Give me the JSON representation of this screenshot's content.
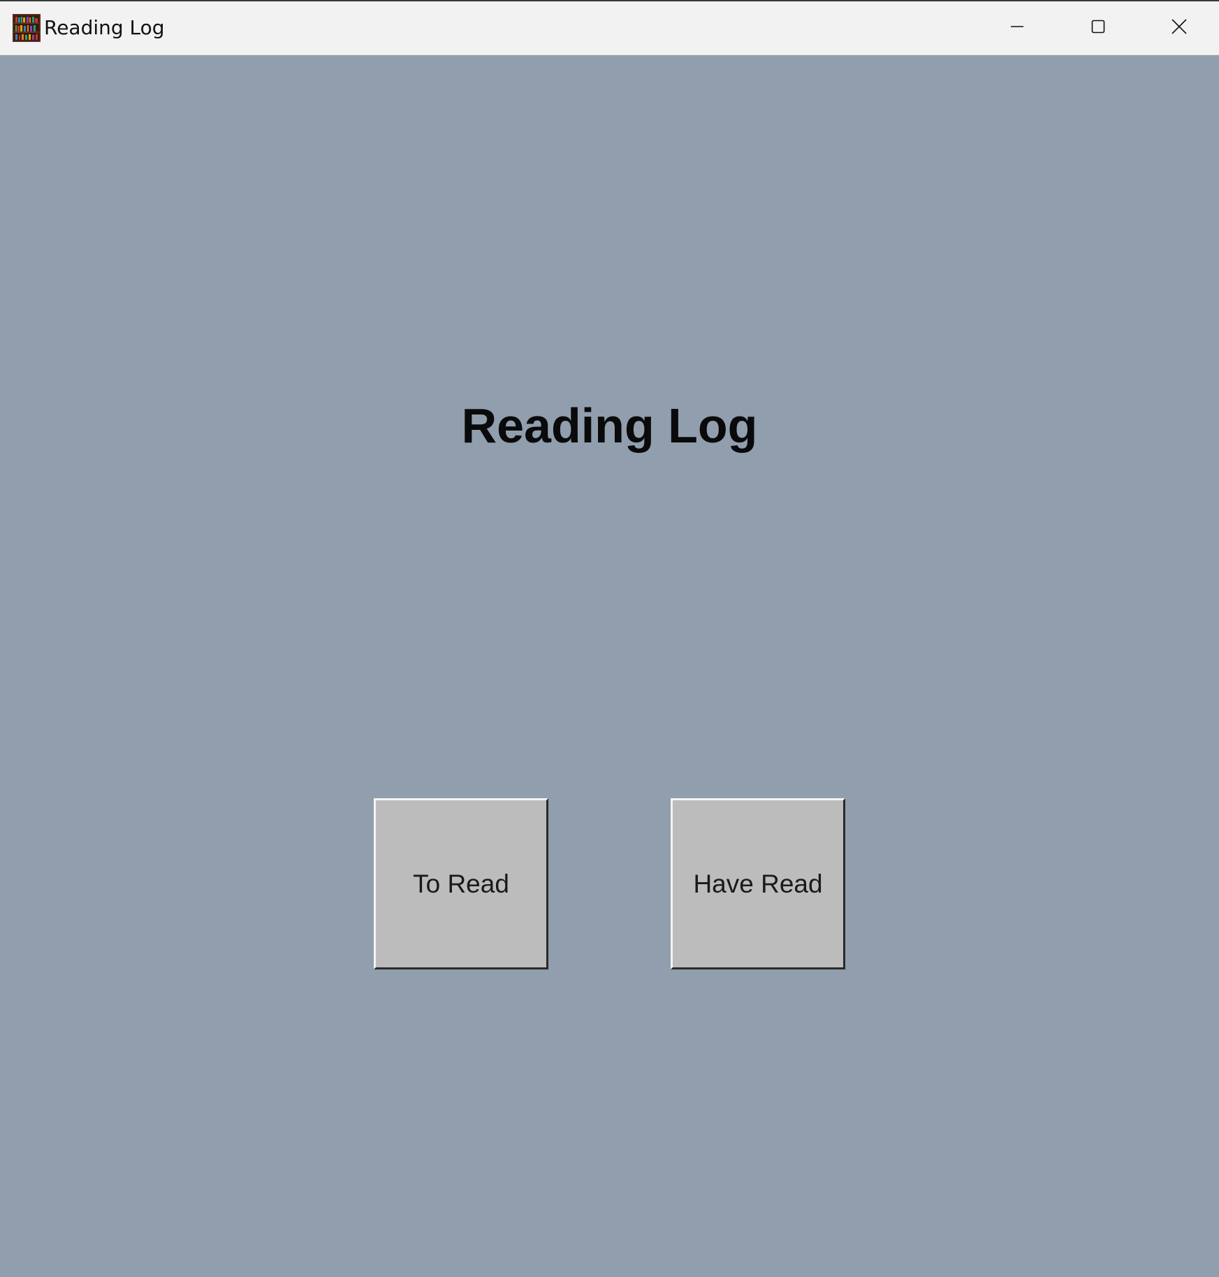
{
  "window": {
    "title": "Reading Log",
    "controls": {
      "minimize_icon": "minimize-icon",
      "maximize_icon": "maximize-icon",
      "close_icon": "close-icon"
    }
  },
  "main": {
    "heading": "Reading Log",
    "buttons": {
      "to_read": "To Read",
      "have_read": "Have Read"
    }
  },
  "colors": {
    "background": "#909eae",
    "button_face": "#bbbcbb",
    "titlebar": "#f2f2f2",
    "text": "#0a0a0a"
  }
}
